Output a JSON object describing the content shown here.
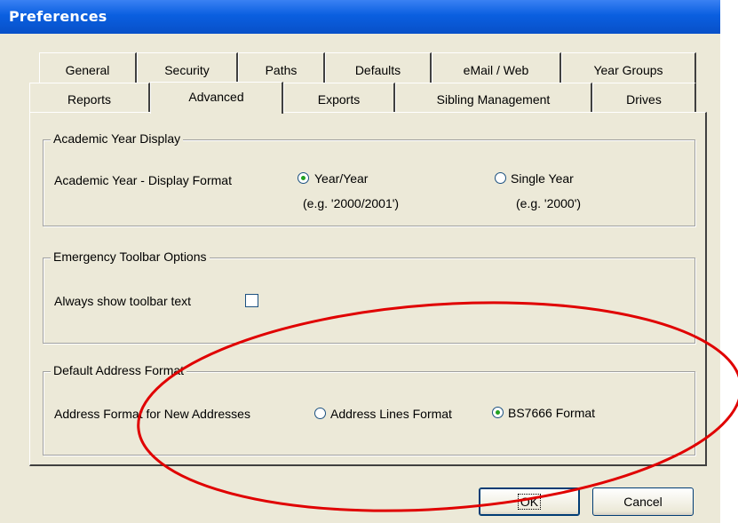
{
  "window": {
    "title": "Preferences"
  },
  "tabs_row1": [
    "General",
    "Security",
    "Paths",
    "Defaults",
    "eMail / Web",
    "Year Groups"
  ],
  "tabs_row2": [
    "Reports",
    "Advanced",
    "Exports",
    "Sibling Management",
    "Drives"
  ],
  "selected_tab": "Advanced",
  "academic_year": {
    "legend": "Academic Year Display",
    "label": "Academic Year - Display Format",
    "option1": "Year/Year",
    "option1_example": "(e.g. '2000/2001')",
    "option2": "Single Year",
    "option2_example": "(e.g. '2000')",
    "selected": "Year/Year"
  },
  "emergency_toolbar": {
    "legend": "Emergency Toolbar Options",
    "label": "Always show toolbar text",
    "checked": false
  },
  "address_format": {
    "legend": "Default Address Format",
    "label": "Address Format for New Addresses",
    "option1": "Address Lines Format",
    "option2": "BS7666 Format",
    "selected": "BS7666 Format"
  },
  "buttons": {
    "ok": "OK",
    "cancel": "Cancel"
  },
  "colors": {
    "title_bar": "#0a5fe0",
    "annotation": "#e00000",
    "radio_dot": "#21a121"
  }
}
